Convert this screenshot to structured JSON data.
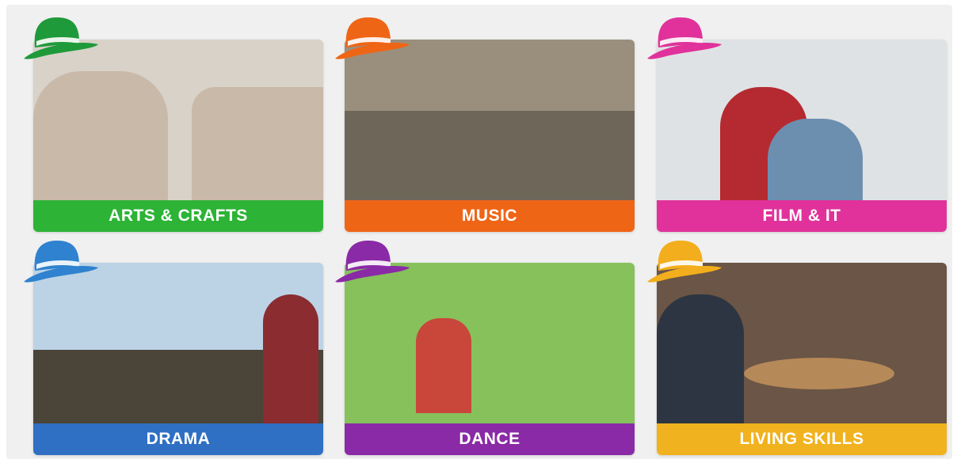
{
  "cards": [
    {
      "label": "ARTS & CRAFTS",
      "color": "#2db336",
      "hat": "#1f9a3a",
      "photo": [
        "#d8d2c8",
        "#c9b9a8",
        "#e04848"
      ]
    },
    {
      "label": "MUSIC",
      "color": "#ef6516",
      "hat": "#ef6516",
      "photo": [
        "#9a8f7d",
        "#6f665a",
        "#3a342d"
      ]
    },
    {
      "label": "FILM & IT",
      "color": "#e0329a",
      "hat": "#e0329a",
      "photo": [
        "#dfe2e4",
        "#b52a30",
        "#6c8fb0"
      ]
    },
    {
      "label": "DRAMA",
      "color": "#2f6fc4",
      "hat": "#2f82cf",
      "photo": [
        "#bcd3e6",
        "#8a2c30",
        "#4b4438"
      ]
    },
    {
      "label": "DANCE",
      "color": "#8a2aa6",
      "hat": "#8a2aa6",
      "photo": [
        "#5f8e4a",
        "#86c15b",
        "#c9463a"
      ]
    },
    {
      "label": "LIVING SKILLS",
      "color": "#f0b21e",
      "hat": "#f2ae1c",
      "photo": [
        "#6a5546",
        "#b68958",
        "#2d3542"
      ]
    }
  ]
}
